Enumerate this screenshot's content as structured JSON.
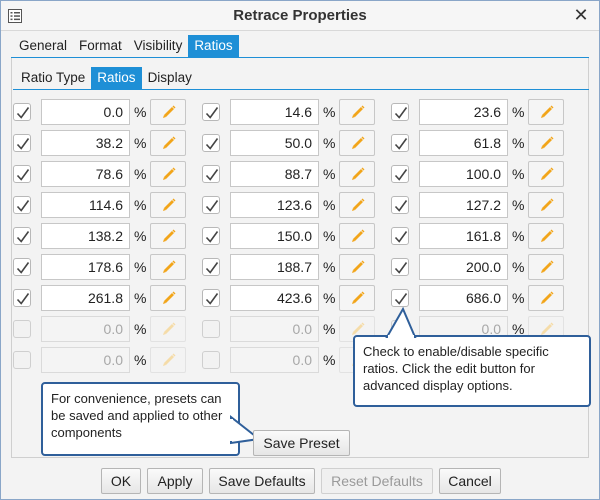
{
  "window": {
    "title": "Retrace Properties"
  },
  "tabs_main": [
    "General",
    "Format",
    "Visibility",
    "Ratios"
  ],
  "tabs_sub": [
    "Ratio Type",
    "Ratios",
    "Display"
  ],
  "ratios": {
    "unit": "%",
    "rows": [
      [
        {
          "checked": true,
          "value": "0.0",
          "enabled": true
        },
        {
          "checked": true,
          "value": "14.6",
          "enabled": true
        },
        {
          "checked": true,
          "value": "23.6",
          "enabled": true
        }
      ],
      [
        {
          "checked": true,
          "value": "38.2",
          "enabled": true
        },
        {
          "checked": true,
          "value": "50.0",
          "enabled": true
        },
        {
          "checked": true,
          "value": "61.8",
          "enabled": true
        }
      ],
      [
        {
          "checked": true,
          "value": "78.6",
          "enabled": true
        },
        {
          "checked": true,
          "value": "88.7",
          "enabled": true
        },
        {
          "checked": true,
          "value": "100.0",
          "enabled": true
        }
      ],
      [
        {
          "checked": true,
          "value": "114.6",
          "enabled": true
        },
        {
          "checked": true,
          "value": "123.6",
          "enabled": true
        },
        {
          "checked": true,
          "value": "127.2",
          "enabled": true
        }
      ],
      [
        {
          "checked": true,
          "value": "138.2",
          "enabled": true
        },
        {
          "checked": true,
          "value": "150.0",
          "enabled": true
        },
        {
          "checked": true,
          "value": "161.8",
          "enabled": true
        }
      ],
      [
        {
          "checked": true,
          "value": "178.6",
          "enabled": true
        },
        {
          "checked": true,
          "value": "188.7",
          "enabled": true
        },
        {
          "checked": true,
          "value": "200.0",
          "enabled": true
        }
      ],
      [
        {
          "checked": true,
          "value": "261.8",
          "enabled": true
        },
        {
          "checked": true,
          "value": "423.6",
          "enabled": true
        },
        {
          "checked": true,
          "value": "686.0",
          "enabled": true
        }
      ],
      [
        {
          "checked": false,
          "value": "0.0",
          "enabled": false
        },
        {
          "checked": false,
          "value": "0.0",
          "enabled": false
        },
        {
          "checked": false,
          "value": "0.0",
          "enabled": false
        }
      ],
      [
        {
          "checked": false,
          "value": "0.0",
          "enabled": false
        },
        {
          "checked": false,
          "value": "0.0",
          "enabled": false
        }
      ]
    ]
  },
  "callouts": {
    "edit_hint": "Check to enable/disable specific ratios.  Click the edit button for advanced display options.",
    "preset_hint": "For convenience, presets can be saved and applied to other components"
  },
  "buttons": {
    "save_preset": "Save Preset",
    "ok": "OK",
    "apply": "Apply",
    "save_defaults": "Save Defaults",
    "reset_defaults": "Reset Defaults",
    "cancel": "Cancel"
  },
  "colors": {
    "accent": "#1e8fd6",
    "pencil": "#f2a51a",
    "callout_border": "#2f5f9a"
  },
  "icons": {
    "title": "properties-icon",
    "close": "close-icon",
    "check": "checkmark-icon",
    "edit": "pencil-icon"
  }
}
